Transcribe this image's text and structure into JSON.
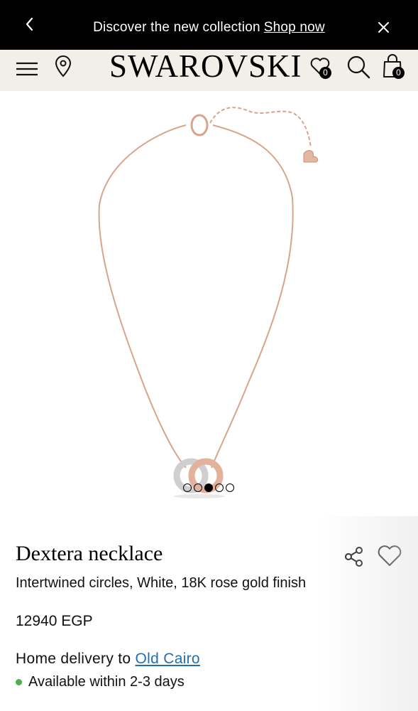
{
  "announcement": {
    "message": "Discover the new collection",
    "link_label": "Shop now"
  },
  "header": {
    "logo": "SWAROVSKI",
    "wishlist_count": "0",
    "bag_count": "0"
  },
  "gallery": {
    "slide_count": 5,
    "active_slide": 3
  },
  "product": {
    "name": "Dextera necklace",
    "description": "Intertwined circles, White, 18K rose gold finish",
    "price": "12940 EGP"
  },
  "delivery": {
    "label": "Home delivery to",
    "location": "Old Cairo",
    "availability": "Available within 2-3 days",
    "availability_color": "#4caf50"
  },
  "colors": {
    "announcement_bg": "#000000",
    "header_bg": "#f1efe8",
    "link": "#1f6fb2",
    "chain": "#d9a48c"
  }
}
